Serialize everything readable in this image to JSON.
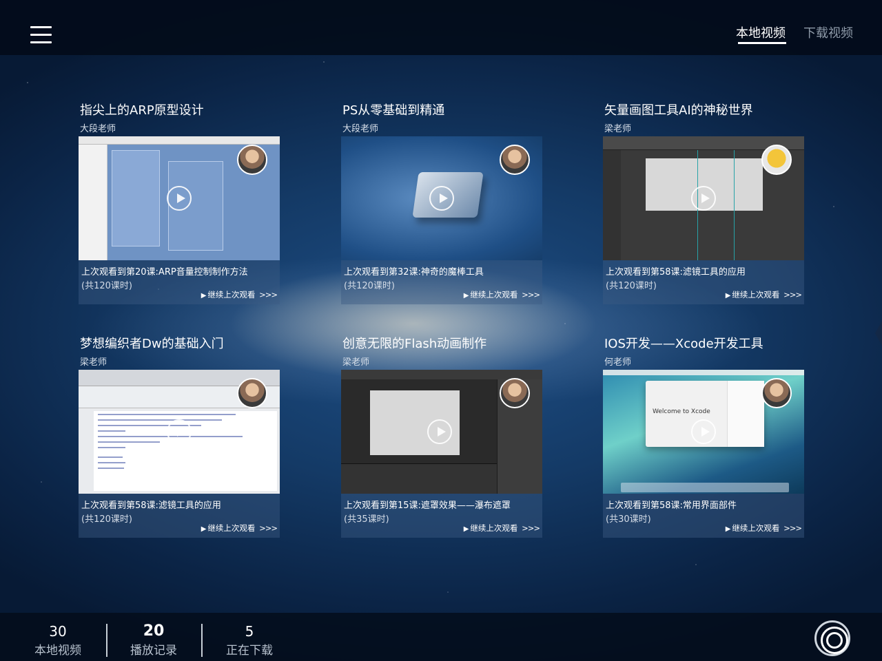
{
  "header": {
    "menu_icon": "hamburger-icon",
    "tabs": [
      {
        "label": "本地视频",
        "active": true
      },
      {
        "label": "下载视频",
        "active": false
      }
    ]
  },
  "courses": [
    {
      "title": "指尖上的ARP原型设计",
      "teacher": "大段老师",
      "progress": "上次观看到第20课:ARP音量控制制作方法",
      "lessons": "(共120课时)",
      "continue": "继续上次观看",
      "arrows": ">>>"
    },
    {
      "title": "PS从零基础到精通",
      "teacher": "大段老师",
      "progress": "上次观看到第32课:神奇的魔棒工具",
      "lessons": "(共120课时)",
      "continue": "继续上次观看",
      "arrows": ">>>"
    },
    {
      "title": "矢量画图工具AI的神秘世界",
      "teacher": "梁老师",
      "progress": "上次观看到第58课:滤镜工具的应用",
      "lessons": "(共120课时)",
      "continue": "继续上次观看",
      "arrows": ">>>"
    },
    {
      "title": "梦想编织者Dw的基础入门",
      "teacher": "梁老师",
      "progress": "上次观看到第58课:滤镜工具的应用",
      "lessons": "(共120课时)",
      "continue": "继续上次观看",
      "arrows": ">>>"
    },
    {
      "title": "创意无限的Flash动画制作",
      "teacher": "梁老师",
      "progress": "上次观看到第15课:遮罩效果——瀑布遮罩",
      "lessons": "(共35课时)",
      "continue": "继续上次观看",
      "arrows": ">>>"
    },
    {
      "title": "IOS开发——Xcode开发工具",
      "teacher": "何老师",
      "progress": "上次观看到第58课:常用界面部件",
      "lessons": "(共30课时)",
      "continue": "继续上次观看",
      "arrows": ">>>",
      "thumb_text": "Welcome to Xcode"
    }
  ],
  "footer": {
    "stats": [
      {
        "count": "30",
        "label": "本地视频"
      },
      {
        "count": "20",
        "label": "播放记录",
        "active": true
      },
      {
        "count": "5",
        "label": "正在下载"
      }
    ],
    "action_icon": "target-icon"
  }
}
